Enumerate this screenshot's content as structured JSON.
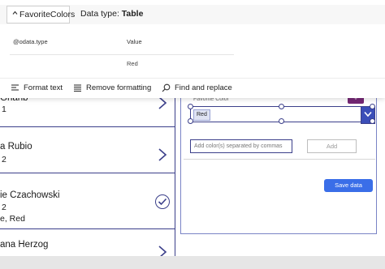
{
  "popup": {
    "field_name": "FavoriteColors",
    "data_type_label": "Data type:",
    "data_type_value": "Table",
    "columns": [
      "@odata.type",
      "Value"
    ],
    "rows": [
      {
        "odata_type": "",
        "value": "Red"
      }
    ]
  },
  "toolbar": {
    "format_text": "Format text",
    "remove_formatting": "Remove formatting",
    "find_replace": "Find and replace"
  },
  "gallery": {
    "items": [
      {
        "name": "Gharib",
        "sub": "1",
        "selected": false
      },
      {
        "name": "a Rubio",
        "sub": "2",
        "selected": false
      },
      {
        "name": "ie Czachowski",
        "sub": "2",
        "sub2": "e, Red",
        "selected": true
      },
      {
        "name": "ana Herzog",
        "selected": false
      }
    ]
  },
  "form": {
    "favorite_color_label": "Favorite Color",
    "selected_chip": "Red",
    "colors_placeholder": "Add color(s) separated by commas",
    "add_label": "Add",
    "save_label": "Save data",
    "plus_icon": "plus-icon"
  },
  "colors": {
    "accent": "#3b3f8a",
    "save_button": "#3a6ee8",
    "badge": "#742774"
  }
}
